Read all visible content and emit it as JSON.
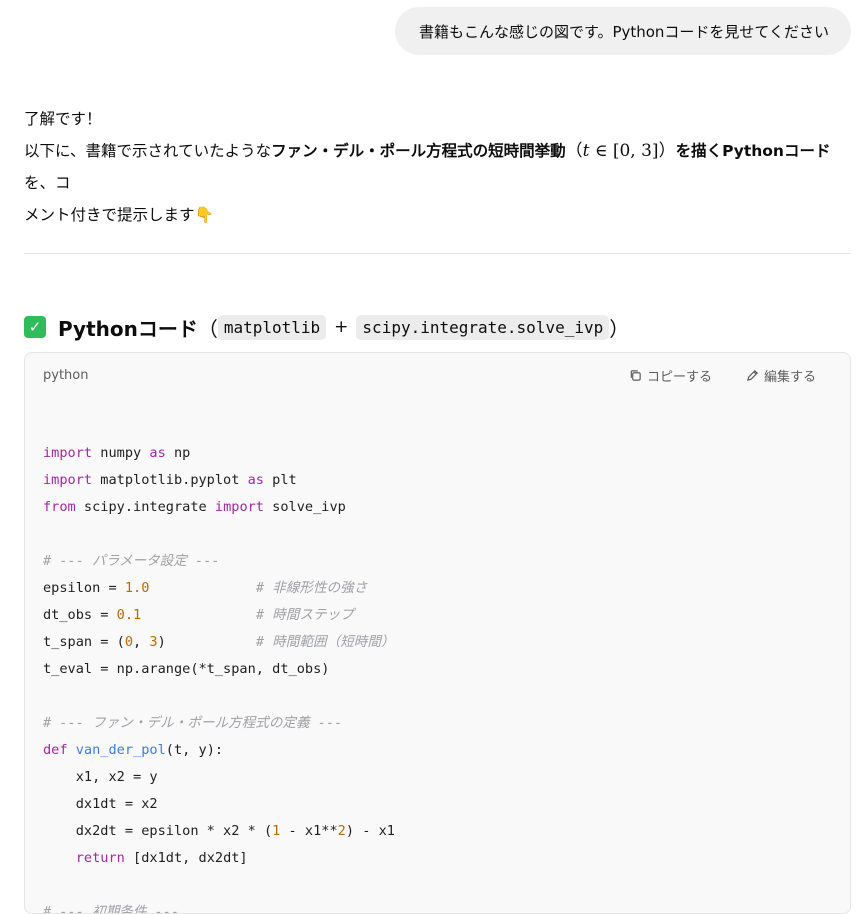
{
  "user_message": "書籍もこんな感じの図です。Pythonコードを見せてください",
  "assistant": {
    "line1": "了解です！",
    "line2_prefix": "以下に、書籍で示されていたような",
    "line2_bold": "ファン・デル・ポール方程式の短時間挙動",
    "math_open": "（",
    "math_t": "t",
    "math_in": " ∈ ",
    "math_interval": "[0, 3]",
    "math_close": "）",
    "line2_bold2": "を描くPythonコード",
    "line2_suffix": "を、コ",
    "line3": "メント付きで提示します",
    "line3_emoji": "👇"
  },
  "section": {
    "title": "Pythonコード",
    "paren_open": "（",
    "lib1": "matplotlib",
    "plus": "+",
    "lib2": "scipy.integrate.solve_ivp",
    "paren_close": "）"
  },
  "code_block": {
    "language": "python",
    "copy_label": "コピーする",
    "edit_label": "編集する",
    "lines": [
      [],
      [
        {
          "t": "kw",
          "v": "import"
        },
        {
          "t": "",
          "v": " numpy "
        },
        {
          "t": "kw",
          "v": "as"
        },
        {
          "t": "",
          "v": " np"
        }
      ],
      [
        {
          "t": "kw",
          "v": "import"
        },
        {
          "t": "",
          "v": " matplotlib.pyplot "
        },
        {
          "t": "kw",
          "v": "as"
        },
        {
          "t": "",
          "v": " plt"
        }
      ],
      [
        {
          "t": "kw",
          "v": "from"
        },
        {
          "t": "",
          "v": " scipy.integrate "
        },
        {
          "t": "kw",
          "v": "import"
        },
        {
          "t": "",
          "v": " solve_ivp"
        }
      ],
      [],
      [
        {
          "t": "cm",
          "v": "# --- パラメータ設定 ---"
        }
      ],
      [
        {
          "t": "",
          "v": "epsilon = "
        },
        {
          "t": "num",
          "v": "1.0"
        },
        {
          "t": "",
          "v": "             "
        },
        {
          "t": "cm",
          "v": "# 非線形性の強さ"
        }
      ],
      [
        {
          "t": "",
          "v": "dt_obs = "
        },
        {
          "t": "num",
          "v": "0.1"
        },
        {
          "t": "",
          "v": "              "
        },
        {
          "t": "cm",
          "v": "# 時間ステップ"
        }
      ],
      [
        {
          "t": "",
          "v": "t_span = ("
        },
        {
          "t": "num",
          "v": "0"
        },
        {
          "t": "",
          "v": ", "
        },
        {
          "t": "num",
          "v": "3"
        },
        {
          "t": "",
          "v": ")           "
        },
        {
          "t": "cm",
          "v": "# 時間範囲（短時間）"
        }
      ],
      [
        {
          "t": "",
          "v": "t_eval = np.arange(*t_span, dt_obs)"
        }
      ],
      [],
      [
        {
          "t": "cm",
          "v": "# --- ファン・デル・ポール方程式の定義 ---"
        }
      ],
      [
        {
          "t": "kw",
          "v": "def"
        },
        {
          "t": "",
          "v": " "
        },
        {
          "t": "fn",
          "v": "van_der_pol"
        },
        {
          "t": "",
          "v": "(t, y):"
        }
      ],
      [
        {
          "t": "",
          "v": "    x1, x2 = y"
        }
      ],
      [
        {
          "t": "",
          "v": "    dx1dt = x2"
        }
      ],
      [
        {
          "t": "",
          "v": "    dx2dt = epsilon * x2 * ("
        },
        {
          "t": "num",
          "v": "1"
        },
        {
          "t": "",
          "v": " - x1**"
        },
        {
          "t": "num",
          "v": "2"
        },
        {
          "t": "",
          "v": ") - x1"
        }
      ],
      [
        {
          "t": "",
          "v": "    "
        },
        {
          "t": "kw",
          "v": "return"
        },
        {
          "t": "",
          "v": " [dx1dt, dx2dt]"
        }
      ],
      [],
      [
        {
          "t": "cm",
          "v": "# --- 初期条件 ---"
        }
      ]
    ]
  }
}
